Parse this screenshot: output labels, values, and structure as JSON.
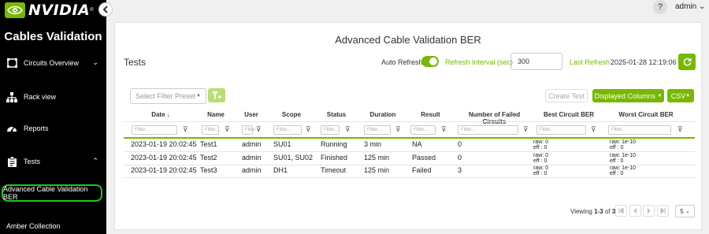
{
  "brand": {
    "name": "NVIDIA",
    "reg": "®",
    "accent": "#76b900"
  },
  "app_title": "Cables Validation",
  "nav": [
    {
      "label": "Circuits Overview",
      "icon": "circuit-icon",
      "chevron": "⌄"
    },
    {
      "label": "Rack view",
      "icon": "network-icon"
    },
    {
      "label": "Reports",
      "icon": "gauge-icon"
    },
    {
      "label": "Tests",
      "icon": "clipboard-icon",
      "chevron": "⌃"
    },
    {
      "label": "Advanced Cable Validation BER",
      "active": true
    },
    {
      "label": "Amber Collection"
    }
  ],
  "topbar": {
    "help": "?",
    "user": "admin",
    "user_caret": "⌄"
  },
  "page_title": "Advanced Cable Validation BER",
  "section_title": "Tests",
  "controls": {
    "auto_refresh_label": "Auto Refresh",
    "auto_refresh_on": true,
    "interval_label": "Refresh Interval (sec)",
    "interval_value": "300",
    "last_refresh_label": "Last Refresh",
    "last_refresh_value": "2025-01-28 12:19:06"
  },
  "toolbar": {
    "preset_placeholder": "Select Filter Preset",
    "create_test": "Create Test",
    "displayed_columns": "Displayed Columns",
    "csv": "CSV"
  },
  "table": {
    "columns": [
      "Date",
      "Name",
      "User",
      "Scope",
      "Status",
      "Duration",
      "Result",
      "Number of Failed Circuits",
      "Best Circuit BER",
      "Worst Circuit BER"
    ],
    "sort_indicator": "↓",
    "filter_placeholder": "Filter...",
    "rows": [
      {
        "date": "2023-01-19 20:02:45",
        "name": "Test1",
        "user": "admin",
        "scope": "SU01",
        "status": "Running",
        "duration": "3 min",
        "result": "NA",
        "failed": "0",
        "best_raw": "raw: 0",
        "best_eff": "eff : 0",
        "worst_raw": "raw: 1e-10",
        "worst_eff": "eff : 0"
      },
      {
        "date": "2023-01-19 20:02:45",
        "name": "Test2",
        "user": "admin",
        "scope": "SU01, SU02",
        "status": "Finished",
        "duration": "125 min",
        "result": "Passed",
        "failed": "0",
        "best_raw": "raw: 0",
        "best_eff": "eff : 0",
        "worst_raw": "raw: 1e-10",
        "worst_eff": "eff : 0"
      },
      {
        "date": "2023-01-19 20:02:45",
        "name": "Test3",
        "user": "admin",
        "scope": "DH1",
        "status": "Timeout",
        "duration": "125 min",
        "result": "Failed",
        "failed": "3",
        "best_raw": "raw: 0",
        "best_eff": "eff : 0",
        "worst_raw": "raw: 1e-10",
        "worst_eff": "eff : 0"
      }
    ]
  },
  "pagination": {
    "viewing_prefix": "Viewing ",
    "range": "1-3",
    "of": " of ",
    "total": "3",
    "page_size": "5"
  }
}
